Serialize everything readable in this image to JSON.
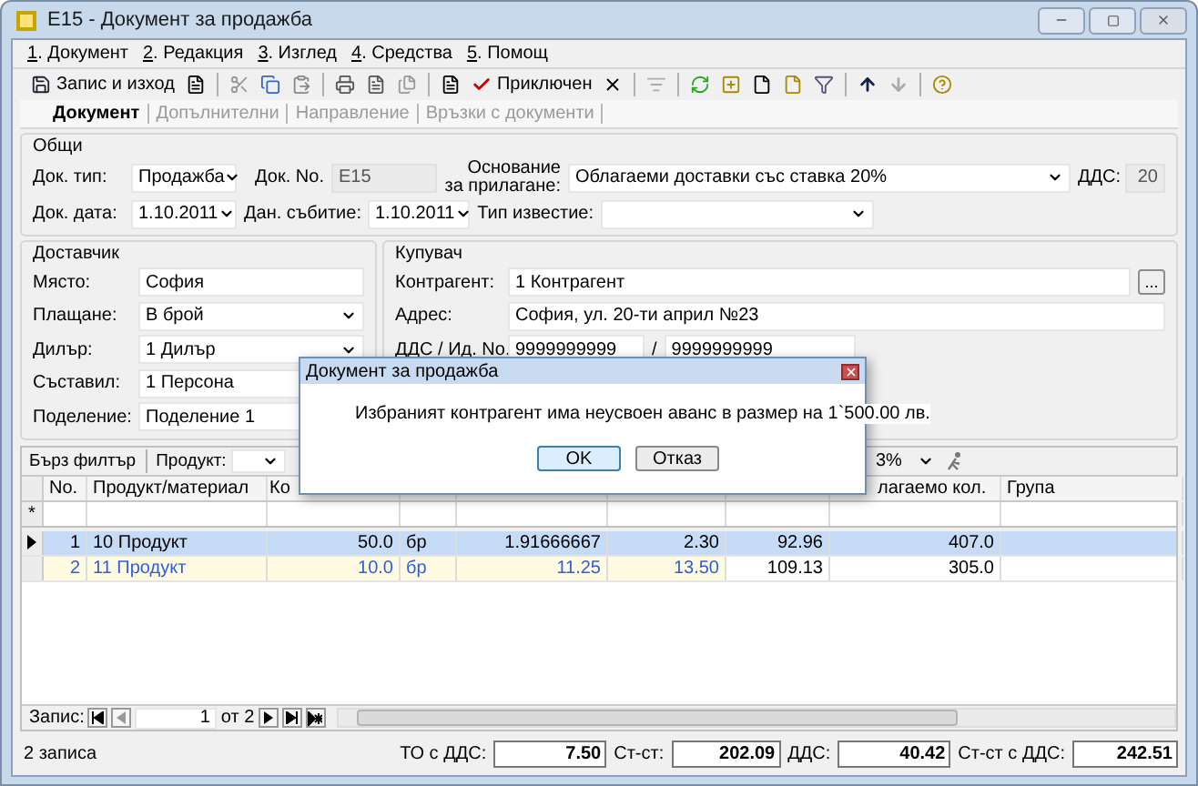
{
  "window": {
    "title": "E15 - Документ за продажба"
  },
  "menu": [
    {
      "key": "1",
      "label": ". Документ"
    },
    {
      "key": "2",
      "label": ". Редакция"
    },
    {
      "key": "3",
      "label": ". Изглед"
    },
    {
      "key": "4",
      "label": ". Средства"
    },
    {
      "key": "5",
      "label": ". Помощ"
    }
  ],
  "toolbar": {
    "save_label": "Запис и изход",
    "close_label": "Приключен"
  },
  "tabs": [
    {
      "label": "Документ",
      "selected": true
    },
    {
      "label": "Допълнителни",
      "selected": false
    },
    {
      "label": "Направление",
      "selected": false
    },
    {
      "label": "Връзки с документи",
      "selected": false
    }
  ],
  "general": {
    "title": "Общи",
    "doc_type_label": "Док. тип:",
    "doc_type": "Продажба",
    "doc_no_label": "Док. No.",
    "doc_no": "E15",
    "basis_label": "Основание за прилагане:",
    "basis": "Облагаеми доставки със ставка 20%",
    "vat_label": "ДДС:",
    "vat": "20",
    "doc_date_label": "Док. дата:",
    "doc_date": "1.10.2011",
    "tax_event_label": "Дан. събитие:",
    "tax_event": "1.10.2011",
    "notice_label": "Тип известие:"
  },
  "supplier": {
    "title": "Доставчик",
    "fields": [
      {
        "label": "Място:",
        "value": "София",
        "kind": "text"
      },
      {
        "label": "Плащане:",
        "value": "В брой",
        "kind": "combo"
      },
      {
        "label": "Дилър:",
        "value": "1 Дилър",
        "kind": "combo"
      },
      {
        "label": "Съставил:",
        "value": "1 Персона",
        "kind": "text"
      },
      {
        "label": "Поделение:",
        "value": "Поделение 1",
        "kind": "text"
      }
    ]
  },
  "buyer": {
    "title": "Купувач",
    "partner_label": "Контрагент:",
    "partner": "1 Контрагент",
    "browse": "...",
    "address_label": "Адрес:",
    "address": "София, ул. 20-ти април №23",
    "vat_id_label": "ДДС / Ид. No.",
    "vat_no": "9999999999",
    "separator": "/",
    "id_no": "9999999999"
  },
  "grid": {
    "filter_label": "Бърз филтър",
    "product_label": "Продукт:",
    "discount": "3%",
    "columns": [
      {
        "label": "No."
      },
      {
        "label": "Продукт/материал"
      },
      {
        "label": "Ко"
      },
      {},
      {},
      {},
      {},
      {
        "label": "лагаемо кол."
      },
      {
        "label": "Група"
      }
    ],
    "new_row_mark": "*",
    "rows": [
      {
        "selected": true,
        "cells": [
          {
            "text": "1",
            "modified": false
          },
          {
            "text": "10 Продукт",
            "modified": false
          },
          {
            "text": "50.0",
            "modified": false
          },
          {
            "text": "бр",
            "modified": false
          },
          {
            "text": "1.91666667",
            "modified": false
          },
          {
            "text": "2.30",
            "modified": false
          },
          {
            "text": "92.96",
            "modified": false
          },
          {
            "text": "407.0",
            "modified": false
          },
          {
            "text": "",
            "modified": false
          }
        ]
      },
      {
        "selected": false,
        "cells": [
          {
            "text": "2",
            "modified": true
          },
          {
            "text": "11 Продукт",
            "modified": true
          },
          {
            "text": "10.0",
            "modified": true
          },
          {
            "text": "бр",
            "modified": true
          },
          {
            "text": "11.25",
            "modified": true
          },
          {
            "text": "13.50",
            "modified": true
          },
          {
            "text": "109.13",
            "modified": false
          },
          {
            "text": "305.0",
            "modified": false
          },
          {
            "text": "",
            "modified": false
          }
        ]
      }
    ]
  },
  "navigator": {
    "label": "Запис:",
    "current": "1",
    "of": "от 2"
  },
  "status": {
    "records": "2 записа",
    "totals": [
      {
        "label": "ТО с ДДС:",
        "value": "7.50"
      },
      {
        "label": "Ст-ст:",
        "value": "202.09"
      },
      {
        "label": "ДДС:",
        "value": "40.42"
      },
      {
        "label": "Ст-ст с ДДС:",
        "value": "242.51"
      }
    ]
  },
  "dialog": {
    "title": "Документ за продажба",
    "message": "Избраният контрагент има неусвоен аванс в размер на 1`500.00 лв.",
    "buttons": [
      {
        "label": "OK",
        "default": true
      },
      {
        "label": "Отказ",
        "default": false
      }
    ]
  }
}
